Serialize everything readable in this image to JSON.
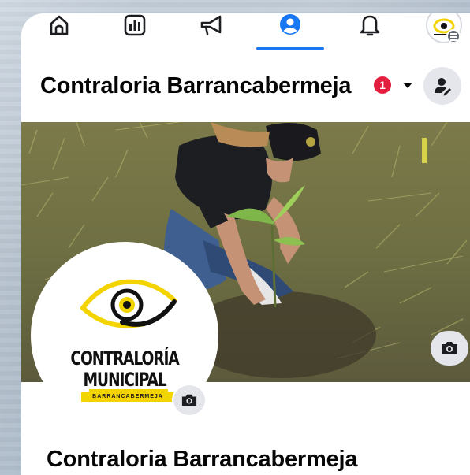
{
  "topnav": {
    "items": [
      {
        "name": "home",
        "icon": "home-icon"
      },
      {
        "name": "dashboard",
        "icon": "dashboard-icon"
      },
      {
        "name": "ads",
        "icon": "megaphone-icon"
      },
      {
        "name": "profile",
        "icon": "profile-icon",
        "active": true
      },
      {
        "name": "notifications",
        "icon": "bell-icon"
      },
      {
        "name": "menu",
        "icon": "avatar-menu-icon"
      }
    ],
    "accent": "#1877f2"
  },
  "header": {
    "page_name": "Contraloria Barrancabermeja",
    "notification_count": "1",
    "badge_color": "#e41e3f",
    "dropdown_icon": "caret-down-icon",
    "switch_icon": "switch-profile-icon"
  },
  "cover": {
    "camera_icon": "camera-icon"
  },
  "profile": {
    "logo_line1": "CONTRALORÍA",
    "logo_line2": "MUNICIPAL",
    "logo_tag": "BARRANCABERMEJA",
    "logo_yellow": "#f4d400",
    "camera_icon": "camera-icon"
  },
  "main": {
    "page_name": "Contraloria Barrancabermeja"
  }
}
